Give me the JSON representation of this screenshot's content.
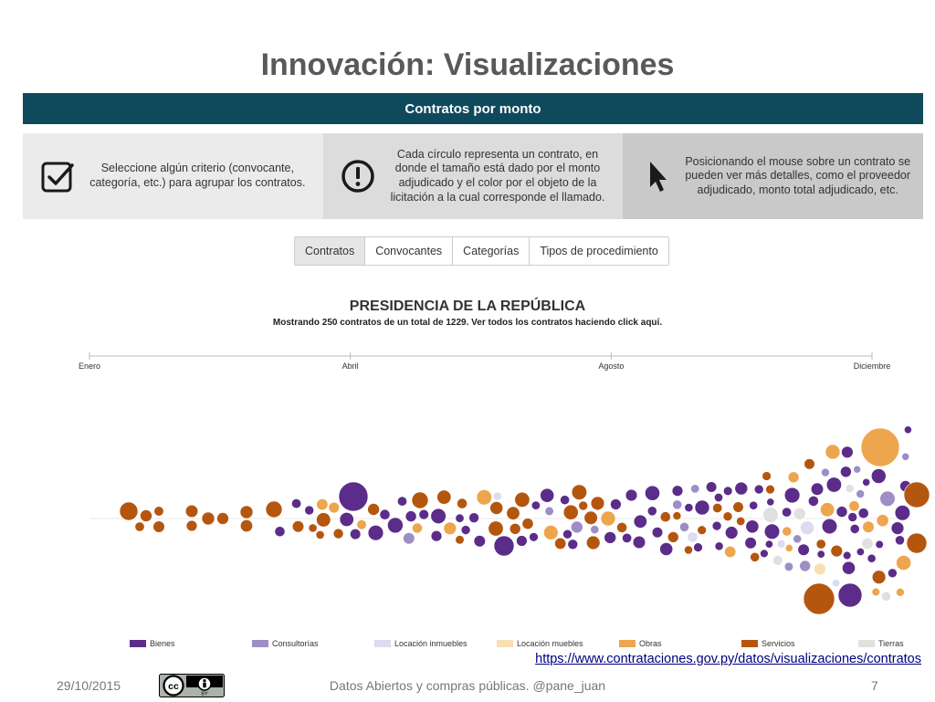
{
  "slide": {
    "title": "Innovación: Visualizaciones",
    "footer_date": "29/10/2015",
    "footer_center": "Datos Abiertos y compras públicas. @pane_juan",
    "page_number": "7",
    "source_url": "https://www.contrataciones.gov.py/datos/visualizaciones/contratos"
  },
  "banner": {
    "title": "Contratos por monto"
  },
  "info_panels": [
    {
      "icon": "checkbox-icon",
      "text": "Seleccione algún criterio (convocante, categoría, etc.) para agrupar los contratos."
    },
    {
      "icon": "exclamation-circle-icon",
      "text": "Cada círculo representa un contrato, en donde el tamaño está dado por el monto adjudicado y el color por el objeto de la licitación a la cual corresponde el llamado."
    },
    {
      "icon": "cursor-arrow-icon",
      "text": "Posicionando el mouse sobre un contrato se pueden ver más detalles, como el proveedor adjudicado, monto total adjudicado, etc."
    }
  ],
  "tabs": [
    {
      "label": "Contratos",
      "active": true
    },
    {
      "label": "Convocantes",
      "active": false
    },
    {
      "label": "Categorías",
      "active": false
    },
    {
      "label": "Tipos de procedimiento",
      "active": false
    }
  ],
  "chart": {
    "title": "PRESIDENCIA DE LA REPÚBLICA",
    "subtitle_text": "Mostrando 250 contratos de un total de 1229. Ver todos los contratos haciendo click ",
    "subtitle_link": "aquí",
    "subtitle_end": "."
  },
  "chart_data": {
    "type": "scatter",
    "x_axis_labels": [
      "Enero",
      "Abril",
      "Agosto",
      "Diciembre"
    ],
    "shown_contracts": 250,
    "total_contracts": 1229,
    "categories": [
      {
        "name": "Bienes",
        "color": "#5b2c8a"
      },
      {
        "name": "Consultorías",
        "color": "#9d8ec6"
      },
      {
        "name": "Locación inmuebles",
        "color": "#dcdcf0"
      },
      {
        "name": "Locación muebles",
        "color": "#f8dfb4"
      },
      {
        "name": "Obras",
        "color": "#eda54e"
      },
      {
        "name": "Servicios",
        "color": "#b5560f"
      },
      {
        "name": "Tierras",
        "color": "#e0e0e0"
      }
    ]
  }
}
